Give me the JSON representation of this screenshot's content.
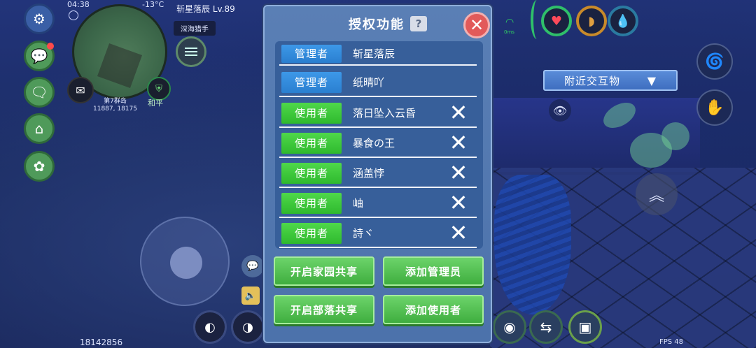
{
  "hud": {
    "time": "04:38",
    "temperature": "-13°C",
    "player_name": "斩星落辰 Lv.89",
    "tribe_tag": "深海猎手",
    "map_label": "第7群岛",
    "map_coords": "11887, 18175",
    "peace_label": "和平",
    "wifi_label": "0ms",
    "nearby_label": "附近交互物",
    "bottom_id": "18142856",
    "fps": "FPS 48"
  },
  "modal": {
    "title": "授权功能",
    "help_label": "?",
    "close_label": "✕",
    "rows": [
      {
        "role": "管理者",
        "role_type": "admin",
        "name": "斩星落辰",
        "removable": false
      },
      {
        "role": "管理者",
        "role_type": "admin",
        "name": "纸晴吖",
        "removable": false
      },
      {
        "role": "使用者",
        "role_type": "user",
        "name": "落日坠入云昏",
        "removable": true
      },
      {
        "role": "使用者",
        "role_type": "user",
        "name": "暴食の王",
        "removable": true
      },
      {
        "role": "使用者",
        "role_type": "user",
        "name": "涵盖悖",
        "removable": true
      },
      {
        "role": "使用者",
        "role_type": "user",
        "name": "岫",
        "removable": true
      },
      {
        "role": "使用者",
        "role_type": "user",
        "name": "詩ヾ",
        "removable": true
      }
    ],
    "buttons": {
      "home_share": "开启家园共享",
      "add_admin": "添加管理员",
      "tribe_share": "开启部落共享",
      "add_user": "添加使用者"
    }
  },
  "colors": {
    "admin": "#2a7fd0",
    "user": "#2fb92e",
    "modal_bg": "#4c72ab",
    "close": "#e25a5a"
  }
}
